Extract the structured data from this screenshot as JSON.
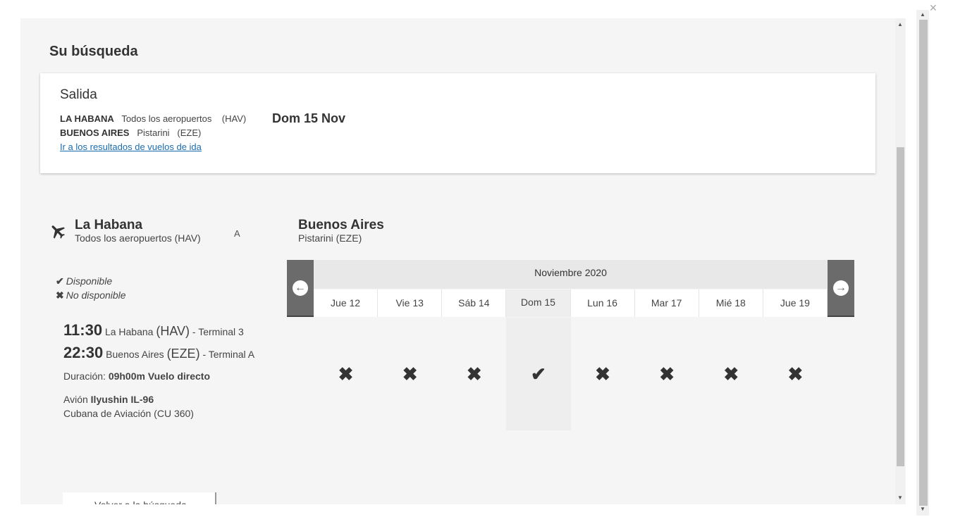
{
  "search": {
    "heading": "Su búsqueda",
    "card_title": "Salida",
    "origin_city": "LA HABANA",
    "origin_airport": "Todos los aeropuertos",
    "origin_code": "(HAV)",
    "dest_city": "BUENOS AIRES",
    "dest_airport": "Pistarini",
    "dest_code": "(EZE)",
    "date": "Dom 15 Nov",
    "results_link": "Ir a los resultados de vuelos de ida"
  },
  "flight": {
    "from_city": "La Habana",
    "from_airport": "Todos los aeropuertos (HAV)",
    "to_label": "A",
    "to_city": "Buenos Aires",
    "to_airport": "Pistarini (EZE)"
  },
  "legend": {
    "available": "Disponible",
    "unavailable": "No disponible"
  },
  "details": {
    "dep_time": "11:30",
    "dep_city": "La Habana",
    "dep_code": "(HAV)",
    "dep_terminal": "- Terminal 3",
    "arr_time": "22:30",
    "arr_city": "Buenos Aires",
    "arr_code": "(EZE)",
    "arr_terminal": "- Terminal A",
    "duration_label": "Duración:",
    "duration_value": "09h00m Vuelo directo",
    "aircraft_label": "Avión",
    "aircraft_value": "Ilyushin IL-96",
    "airline": "Cubana de Aviación (CU 360)"
  },
  "calendar": {
    "month": "Noviembre 2020",
    "days": [
      {
        "label": "Jue 12",
        "available": false
      },
      {
        "label": "Vie 13",
        "available": false
      },
      {
        "label": "Sáb 14",
        "available": false
      },
      {
        "label": "Dom 15",
        "available": true
      },
      {
        "label": "Lun 16",
        "available": false
      },
      {
        "label": "Mar 17",
        "available": false
      },
      {
        "label": "Mié 18",
        "available": false
      },
      {
        "label": "Jue 19",
        "available": false
      }
    ],
    "selected_index": 3
  },
  "bottom_box_text": "Volver a la búsqueda",
  "icons": {
    "plane": "plane-icon",
    "check": "check-icon",
    "cross": "cross-icon",
    "prev": "arrow-left-circle-icon",
    "next": "arrow-right-circle-icon",
    "close": "close-icon"
  },
  "colors": {
    "link": "#1a6cb0",
    "nav_button": "#6b6b6b",
    "selected_day": "#eeeeee",
    "background": "#f5f5f5"
  }
}
